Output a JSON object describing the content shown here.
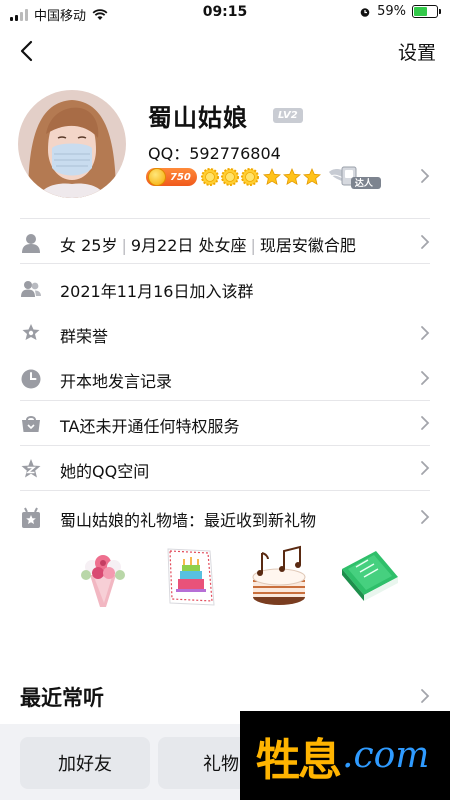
{
  "status_bar": {
    "carrier": "中国移动",
    "time": "09:15",
    "battery": "59%",
    "battery_level": 0.59
  },
  "nav": {
    "back_icon": "chevron-left-icon",
    "settings": "设置"
  },
  "profile": {
    "name": "蜀山姑娘",
    "level": "LV2",
    "qq_label": "QQ：",
    "qq_number": "592776804",
    "coin_value": "750",
    "suns": 3,
    "stars": 3,
    "talent": "达人"
  },
  "rows": [
    {
      "icon": "person-icon",
      "parts": [
        "女 25岁",
        "9月22日 处女座",
        "现居安徽合肥"
      ]
    },
    {
      "icon": "group-icon",
      "label": "2021年11月16日加入该群"
    },
    {
      "icon": "honor-star-icon",
      "label": "群荣誉"
    },
    {
      "icon": "clock-icon",
      "label": "开本地发言记录"
    },
    {
      "icon": "privilege-icon",
      "label": "TA还未开通任何特权服务"
    },
    {
      "icon": "qzone-icon",
      "label": "她的QQ空间"
    },
    {
      "icon": "gift-wall-icon",
      "label": "蜀山姑娘的礼物墙：最近收到新礼物"
    }
  ],
  "gifts": [
    {
      "icon": "flower-bouquet-icon"
    },
    {
      "icon": "birthday-card-icon"
    },
    {
      "icon": "music-cake-icon"
    },
    {
      "icon": "green-book-icon"
    }
  ],
  "section": {
    "title": "最近常听"
  },
  "bottom": {
    "add_friend": "加好友",
    "gift": "礼物"
  },
  "watermark": {
    "cn": "牲息",
    "com": ".com"
  },
  "colors": {
    "accent_orange": "#f0591c",
    "star_gold": "#ffc21a",
    "icon_gray": "#9a9ca3"
  }
}
